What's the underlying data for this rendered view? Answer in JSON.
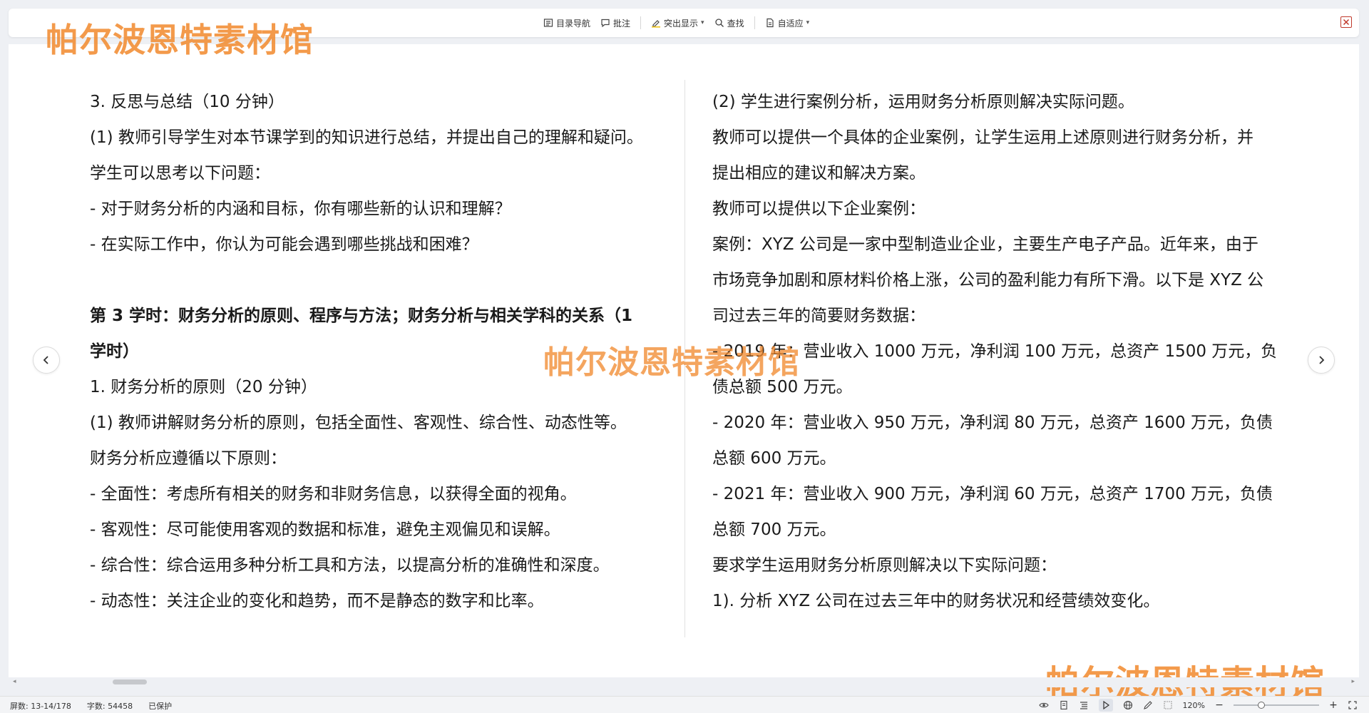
{
  "toolbar": {
    "items": [
      {
        "label": "目录导航",
        "icon": "toc-icon"
      },
      {
        "label": "批注",
        "icon": "comment-icon"
      },
      {
        "label": "突出显示",
        "icon": "highlight-icon"
      },
      {
        "label": "查找",
        "icon": "search-icon"
      },
      {
        "label": "自适应",
        "icon": "page-fit-icon"
      }
    ]
  },
  "watermark": {
    "text_top": "帕尔波恩特素材馆",
    "text_center": "帕尔波恩特素材馆",
    "text_bottom": "帕尔波恩特素材馆",
    "color": "#F18C32"
  },
  "left_column": [
    {
      "text": "3. 反思与总结（10 分钟）",
      "bold": false
    },
    {
      "text": "(1) 教师引导学生对本节课学到的知识进行总结，并提出自己的理解和疑问。",
      "bold": false
    },
    {
      "text": "学生可以思考以下问题：",
      "bold": false
    },
    {
      "text": "- 对于财务分析的内涵和目标，你有哪些新的认识和理解？",
      "bold": false
    },
    {
      "text": "- 在实际工作中，你认为可能会遇到哪些挑战和困难？",
      "bold": false
    },
    {
      "text": "",
      "bold": false
    },
    {
      "text": "第 3 学时：财务分析的原则、程序与方法；财务分析与相关学科的关系（1",
      "bold": true
    },
    {
      "text": "学时）",
      "bold": true
    },
    {
      "text": "1. 财务分析的原则（20 分钟）",
      "bold": false
    },
    {
      "text": "(1) 教师讲解财务分析的原则，包括全面性、客观性、综合性、动态性等。",
      "bold": false
    },
    {
      "text": "财务分析应遵循以下原则：",
      "bold": false
    },
    {
      "text": "- 全面性：考虑所有相关的财务和非财务信息，以获得全面的视角。",
      "bold": false
    },
    {
      "text": "- 客观性：尽可能使用客观的数据和标准，避免主观偏见和误解。",
      "bold": false
    },
    {
      "text": "- 综合性：综合运用多种分析工具和方法，以提高分析的准确性和深度。",
      "bold": false
    },
    {
      "text": "- 动态性：关注企业的变化和趋势，而不是静态的数字和比率。",
      "bold": false
    }
  ],
  "right_column": [
    {
      "text": "(2) 学生进行案例分析，运用财务分析原则解决实际问题。",
      "bold": false
    },
    {
      "text": "教师可以提供一个具体的企业案例，让学生运用上述原则进行财务分析，并",
      "bold": false
    },
    {
      "text": "提出相应的建议和解决方案。",
      "bold": false
    },
    {
      "text": "教师可以提供以下企业案例：",
      "bold": false
    },
    {
      "text": "案例：XYZ 公司是一家中型制造业企业，主要生产电子产品。近年来，由于",
      "bold": false
    },
    {
      "text": "市场竞争加剧和原材料价格上涨，公司的盈利能力有所下滑。以下是 XYZ 公",
      "bold": false
    },
    {
      "text": "司过去三年的简要财务数据：",
      "bold": false
    },
    {
      "text": "- 2019 年：营业收入 1000 万元，净利润 100 万元，总资产 1500 万元，负",
      "bold": false
    },
    {
      "text": "债总额 500 万元。",
      "bold": false
    },
    {
      "text": "- 2020 年：营业收入 950 万元，净利润 80 万元，总资产 1600 万元，负债",
      "bold": false
    },
    {
      "text": "总额 600 万元。",
      "bold": false
    },
    {
      "text": "- 2021 年：营业收入 900 万元，净利润 60 万元，总资产 1700 万元，负债",
      "bold": false
    },
    {
      "text": "总额 700 万元。",
      "bold": false
    },
    {
      "text": "要求学生运用财务分析原则解决以下实际问题：",
      "bold": false
    },
    {
      "text": "1). 分析 XYZ 公司在过去三年中的财务状况和经营绩效变化。",
      "bold": false
    }
  ],
  "statusbar": {
    "page_info": "屏数: 13-14/178",
    "word_count": "字数: 54458",
    "protect": "已保护",
    "zoom": "120%",
    "zoom_fraction": 0.3
  },
  "icons": {
    "close": "close-icon",
    "nav_prev": "chevron-left-icon",
    "nav_next": "chevron-right-icon"
  }
}
